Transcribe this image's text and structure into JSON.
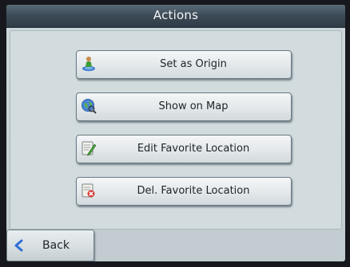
{
  "header": {
    "title": "Actions"
  },
  "actions": [
    {
      "label": "Set as Origin",
      "icon": "origin-person-icon"
    },
    {
      "label": "Show on Map",
      "icon": "map-globe-icon"
    },
    {
      "label": "Edit Favorite Location",
      "icon": "edit-favorite-icon"
    },
    {
      "label": "Del. Favorite Location",
      "icon": "delete-favorite-icon"
    }
  ],
  "footer": {
    "back_label": "Back",
    "back_icon": "chevron-left-icon"
  },
  "colors": {
    "titlebar": "#3d4c58",
    "screen_background": "#cdd8dc",
    "button_border": "#6a7a83",
    "back_chevron": "#2f6fd6"
  }
}
